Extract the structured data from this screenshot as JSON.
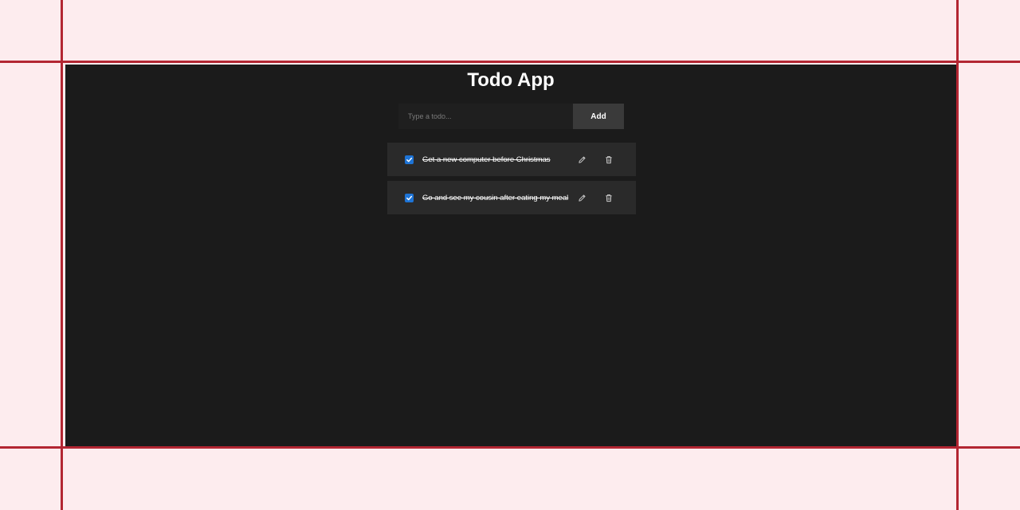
{
  "app": {
    "title": "Todo App"
  },
  "form": {
    "placeholder": "Type a todo...",
    "value": "",
    "add_label": "Add"
  },
  "todos": [
    {
      "text": "Get a new computer before Christmas",
      "completed": true
    },
    {
      "text": "Go and see my cousin after eating my meal",
      "completed": true
    }
  ],
  "icons": {
    "check": "checkmark-icon",
    "edit": "pencil-icon",
    "delete": "trash-icon"
  },
  "colors": {
    "page_background": "#fdecee",
    "frame_lines": "#b32632",
    "app_background": "#1b1b1b",
    "item_background": "#2a2a2a",
    "button_background": "#3a3a3a",
    "checkbox_accent": "#1e74d6"
  }
}
